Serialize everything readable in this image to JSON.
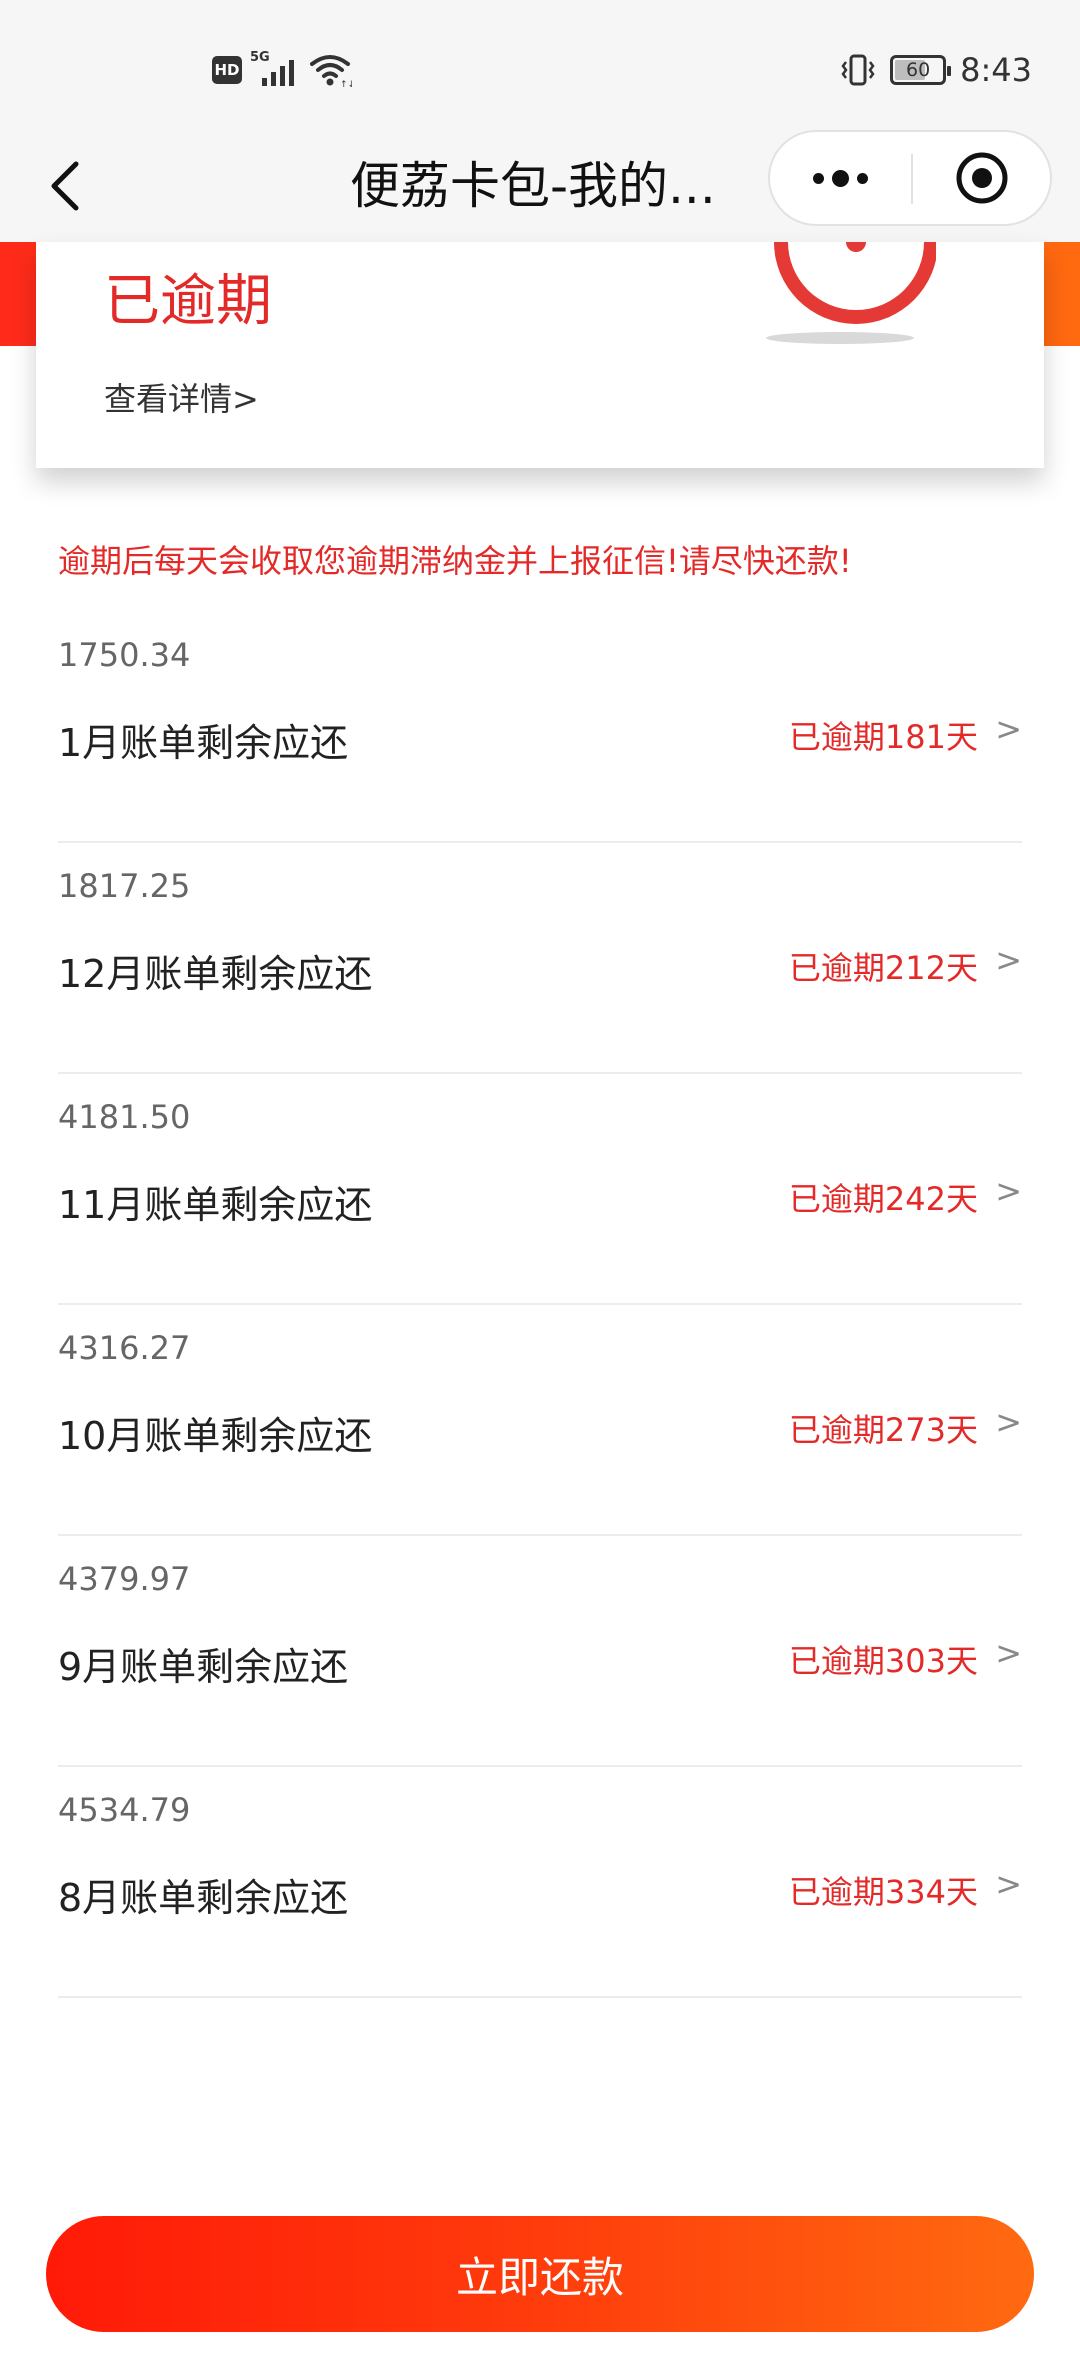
{
  "status_bar": {
    "hd_badge": "HD",
    "network": "5G",
    "battery": "60",
    "time": "8:43"
  },
  "nav": {
    "title": "便荔卡包-我的..."
  },
  "card": {
    "status": "已逾期",
    "detail_link": "查看详情>"
  },
  "warning": "逾期后每天会收取您逾期滞纳金并上报征信!请尽快还款!",
  "bills": [
    {
      "amount": "1750.34",
      "title": "1月账单剩余应还",
      "status": "已逾期181天",
      "chevron": ">"
    },
    {
      "amount": "1817.25",
      "title": "12月账单剩余应还",
      "status": "已逾期212天",
      "chevron": ">"
    },
    {
      "amount": "4181.50",
      "title": "11月账单剩余应还",
      "status": "已逾期242天",
      "chevron": ">"
    },
    {
      "amount": "4316.27",
      "title": "10月账单剩余应还",
      "status": "已逾期273天",
      "chevron": ">"
    },
    {
      "amount": "4379.97",
      "title": "9月账单剩余应还",
      "status": "已逾期303天",
      "chevron": ">"
    },
    {
      "amount": "4534.79",
      "title": "8月账单剩余应还",
      "status": "已逾期334天",
      "chevron": ">"
    }
  ],
  "footer": {
    "pay_button": "立即还款"
  },
  "colors": {
    "accent_red": "#e32a28",
    "gradient_start": "#ff1a08",
    "gradient_end": "#ff6a10"
  },
  "icons": {
    "back": "chevron-left-icon",
    "more": "more-dots-icon",
    "close": "target-icon",
    "clock": "clock-illustration-icon"
  }
}
